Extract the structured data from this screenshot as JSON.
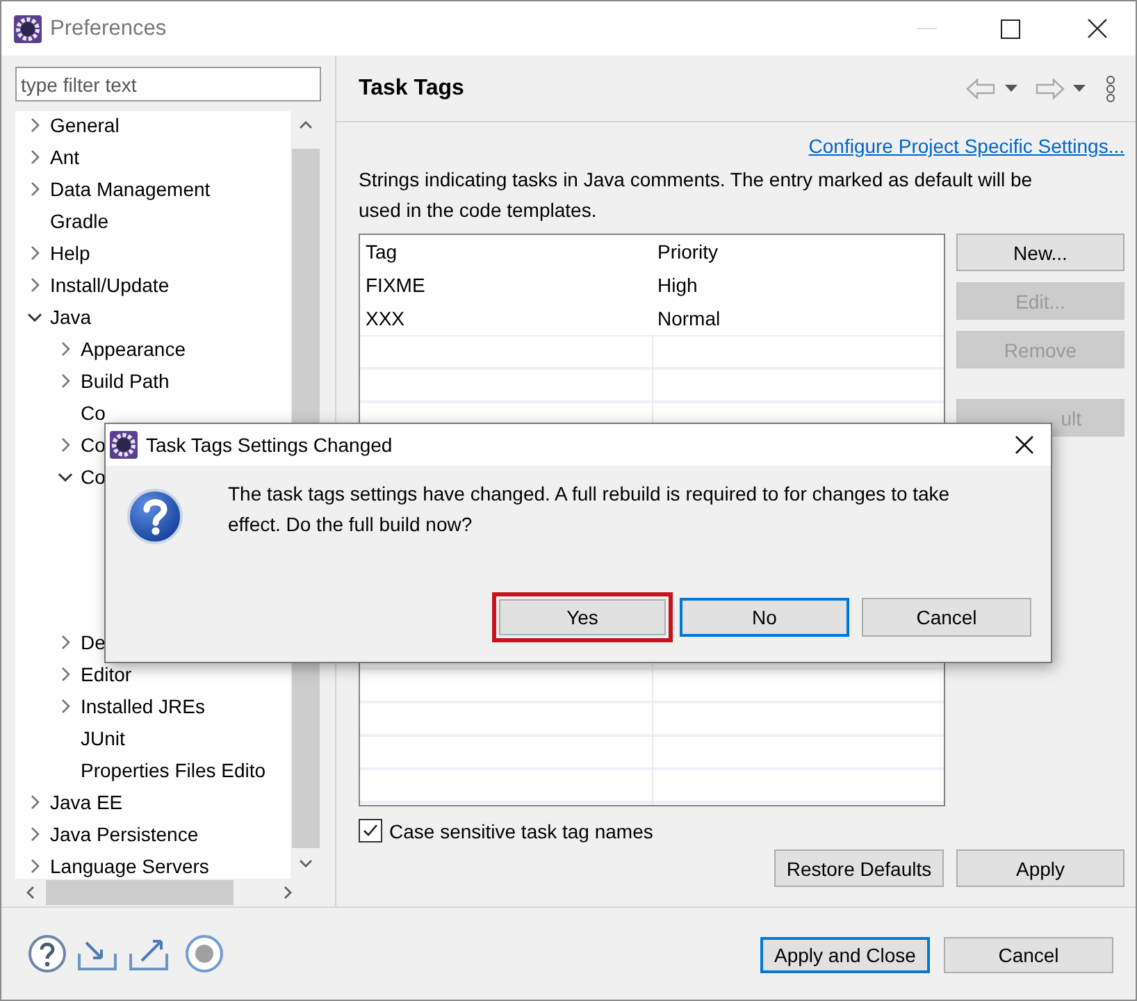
{
  "window": {
    "title": "Preferences"
  },
  "filter": {
    "placeholder": "type filter text"
  },
  "tree": [
    {
      "label": "General",
      "expandable": true,
      "expanded": false
    },
    {
      "label": "Ant",
      "expandable": true,
      "expanded": false
    },
    {
      "label": "Data Management",
      "expandable": true,
      "expanded": false
    },
    {
      "label": "Gradle",
      "expandable": false
    },
    {
      "label": "Help",
      "expandable": true,
      "expanded": false
    },
    {
      "label": "Install/Update",
      "expandable": true,
      "expanded": false
    },
    {
      "label": "Java",
      "expandable": true,
      "expanded": true,
      "children": [
        {
          "label": "Appearance",
          "expandable": true,
          "expanded": false
        },
        {
          "label": "Build Path",
          "expandable": true,
          "expanded": false
        },
        {
          "label": "Co",
          "expandable": false
        },
        {
          "label": "Co",
          "expandable": true,
          "expanded": false
        },
        {
          "label": "Co",
          "expandable": true,
          "expanded": true
        },
        {
          "label": "De",
          "expandable": true,
          "expanded": false
        },
        {
          "label": "Editor",
          "expandable": true,
          "expanded": false
        },
        {
          "label": "Installed JREs",
          "expandable": true,
          "expanded": false
        },
        {
          "label": "JUnit",
          "expandable": false
        },
        {
          "label": "Properties Files Edito",
          "expandable": false
        }
      ]
    },
    {
      "label": "Java EE",
      "expandable": true,
      "expanded": false
    },
    {
      "label": "Java Persistence",
      "expandable": true,
      "expanded": false
    },
    {
      "label": "Language Servers",
      "expandable": true,
      "expanded": false
    }
  ],
  "page": {
    "title": "Task Tags",
    "link": "Configure Project Specific Settings...",
    "description": "Strings indicating tasks in Java comments. The entry marked as default will be used in the code templates.",
    "table": {
      "columns": [
        "Tag",
        "Priority"
      ],
      "rows": [
        [
          "FIXME",
          "High"
        ],
        [
          "XXX",
          "Normal"
        ]
      ]
    },
    "side_buttons": [
      {
        "label": "New...",
        "disabled": false
      },
      {
        "label": "Edit...",
        "disabled": true
      },
      {
        "label": "Remove",
        "disabled": true
      },
      {
        "label": "ult",
        "disabled": true
      }
    ],
    "case_sensitive": {
      "label": "Case sensitive task tag names",
      "checked": true
    },
    "buttons": [
      "Restore Defaults",
      "Apply"
    ]
  },
  "footer": {
    "buttons": [
      {
        "label": "Apply and Close",
        "default": true
      },
      {
        "label": "Cancel",
        "default": false
      }
    ]
  },
  "dialog": {
    "title": "Task Tags Settings Changed",
    "message": "The task tags settings have changed. A full rebuild is required to for changes to take effect. Do the full build now?",
    "buttons": [
      {
        "label": "Yes",
        "default": false,
        "highlighted": true
      },
      {
        "label": "No",
        "default": true,
        "highlighted": false
      },
      {
        "label": "Cancel",
        "default": false,
        "highlighted": false
      }
    ]
  }
}
